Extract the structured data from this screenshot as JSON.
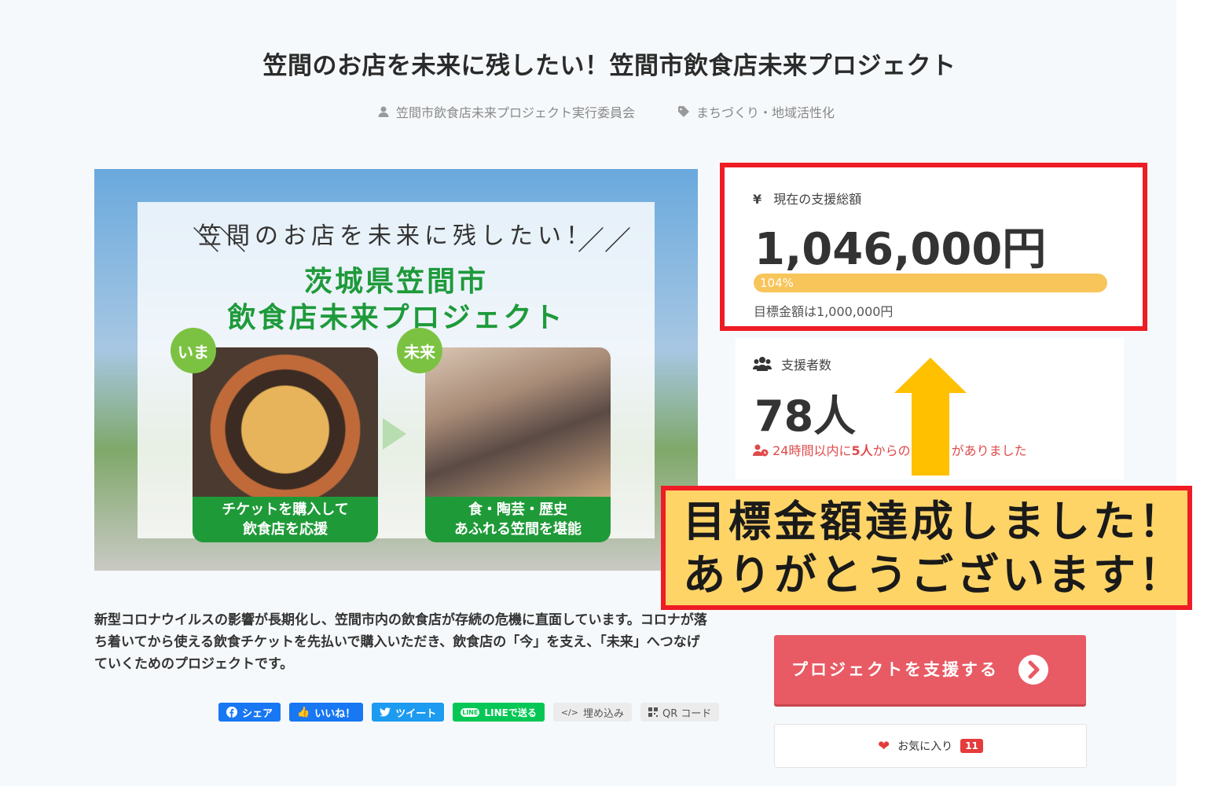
{
  "project": {
    "title": "笠間のお店を未来に残したい！笠間市飲食店未来プロジェクト",
    "owner": "笠間市飲食店未来プロジェクト実行委員会",
    "category": "まちづくり・地域活性化"
  },
  "hero": {
    "tagline": "笠間のお店を未来に残したい！",
    "title_line1": "茨城県笠間市",
    "title_line2": "飲食店未来プロジェクト",
    "now_label": "いま",
    "future_label": "未来",
    "left_caption_1": "チケットを購入して",
    "left_caption_2": "飲食店を応援",
    "right_caption_1": "食・陶芸・歴史",
    "right_caption_2": "あふれる笠間を堪能"
  },
  "funding": {
    "label": "現在の支援総額",
    "amount": "1,046,000円",
    "percent_text": "104%",
    "percent_value": 104,
    "goal_text": "目標金額は1,000,000円"
  },
  "supporters": {
    "label": "支援者数",
    "count": "78人",
    "recent_prefix": "24時間以内に",
    "recent_num": "5人",
    "recent_middle": "からの",
    "recent_suffix": "がありました"
  },
  "announcement": {
    "line1": "目標金額達成しました！",
    "line2": "ありがとうございます！"
  },
  "description": "新型コロナウイルスの影響が長期化し、笠間市内の飲食店が存続の危機に直面しています。コロナが落ち着いてから使える飲食チケットを先払いで購入いただき、飲食店の「今」を支え、「未来」へつなげていくためのプロジェクトです。",
  "share": {
    "facebook": "シェア",
    "like": "いいね！",
    "tweet": "ツイート",
    "line": "LINEで送る",
    "embed": "埋め込み",
    "qr": "QR コード"
  },
  "actions": {
    "support_label": "プロジェクトを支援する",
    "favorite_label": "お気に入り",
    "favorite_count": "11"
  },
  "colors": {
    "highlight_border": "#ee1c25",
    "progress": "#f8c55a",
    "support_button": "#e85a64",
    "announcement_bg": "#ffd467",
    "arrow": "#ffc000"
  }
}
